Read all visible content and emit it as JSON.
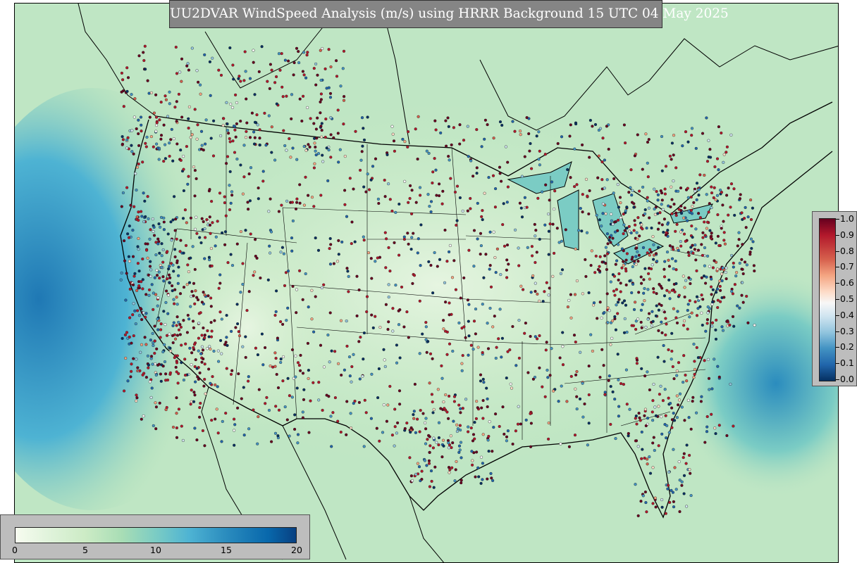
{
  "title": "UU2DVAR WindSpeed Analysis (m/s) using HRRR Background 15 UTC 04 May 2025",
  "map": {
    "field": "WindSpeed",
    "units": "m/s",
    "background_model": "HRRR",
    "stations_colormap": "red-blue diverging"
  },
  "colorbar_observations": {
    "ticks": [
      "1.0",
      "0.9",
      "0.8",
      "0.7",
      "0.6",
      "0.5",
      "0.4",
      "0.3",
      "0.2",
      "0.1",
      "0.0"
    ],
    "colors": [
      "#67001f",
      "#b2182b",
      "#d6604d",
      "#f4a582",
      "#fddbc7",
      "#f7f7f7",
      "#d1e5f0",
      "#92c5de",
      "#4393c3",
      "#2166ac",
      "#053061"
    ]
  },
  "colorbar_windspeed": {
    "ticks": [
      "0",
      "5",
      "10",
      "15",
      "20"
    ],
    "colors": [
      "#f7fcf0",
      "#ccebc5",
      "#7bccc4",
      "#2b8cbe",
      "#084081"
    ]
  }
}
